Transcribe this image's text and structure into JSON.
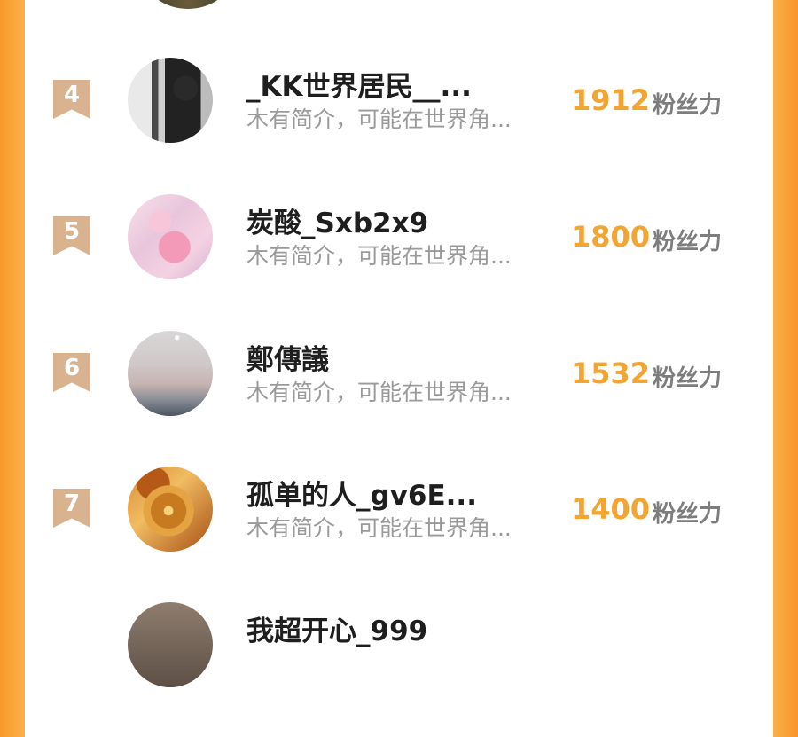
{
  "rows": [
    {
      "rank": "4",
      "name": "_KK世界居民__...",
      "desc": "木有简介，可能在世界角...",
      "score": "1912",
      "unit": "粉丝力",
      "avatar_icon": "person-avatar-icon"
    },
    {
      "rank": "5",
      "name": "炭酸_Sxb2x9",
      "desc": "木有简介，可能在世界角...",
      "score": "1800",
      "unit": "粉丝力",
      "avatar_icon": "pink-avatar-icon"
    },
    {
      "rank": "6",
      "name": "鄭傳議",
      "desc": "木有简介，可能在世界角...",
      "score": "1532",
      "unit": "粉丝力",
      "avatar_icon": "sky-avatar-icon"
    },
    {
      "rank": "7",
      "name": "孤单的人_gv6E...",
      "desc": "木有简介，可能在世界角...",
      "score": "1400",
      "unit": "粉丝力",
      "avatar_icon": "compass-avatar-icon"
    },
    {
      "rank": "",
      "name": "我超开心_999",
      "desc": "",
      "score": "",
      "unit": "",
      "avatar_icon": "partial-avatar-icon"
    }
  ],
  "colors": {
    "accent": "#f3a532",
    "side_bars": "#f89a2b",
    "rank_flag": "#d9b38f",
    "name": "#1e1e1e",
    "desc": "#9a9a9a"
  }
}
